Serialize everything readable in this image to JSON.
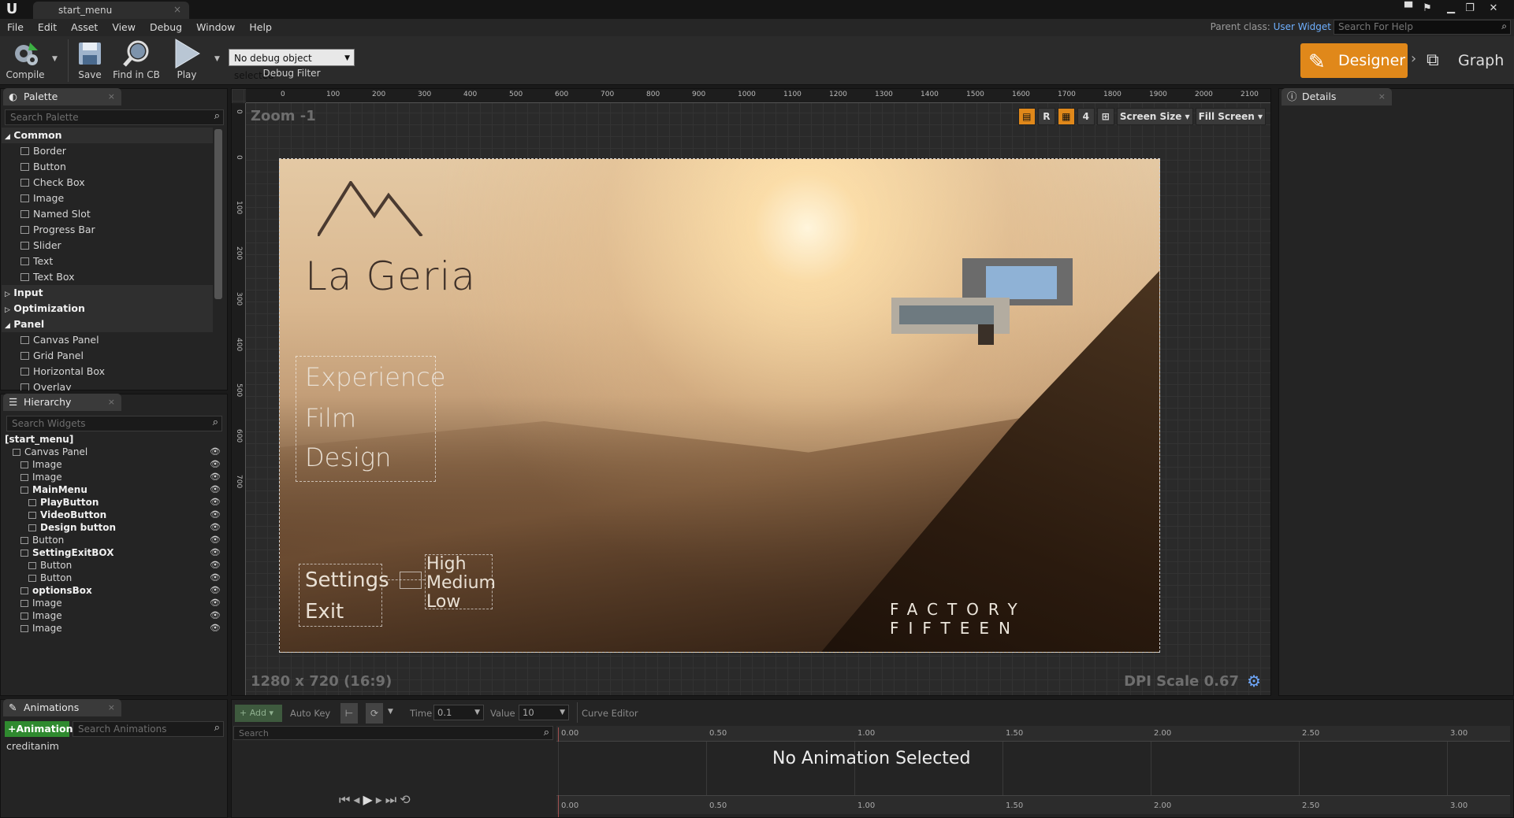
{
  "window": {
    "tab_title": "start_menu",
    "parent_class_label": "Parent class:",
    "parent_class_value": "User Widget",
    "help_search_placeholder": "Search For Help"
  },
  "menu": [
    "File",
    "Edit",
    "Asset",
    "View",
    "Debug",
    "Window",
    "Help"
  ],
  "toolbar": {
    "compile": "Compile",
    "save": "Save",
    "find_in_cb": "Find in CB",
    "play": "Play",
    "debug_object": "No debug object selected",
    "debug_filter": "Debug Filter",
    "designer": "Designer",
    "graph": "Graph"
  },
  "palette": {
    "tab": "Palette",
    "search_placeholder": "Search Palette",
    "common": "Common",
    "common_items": [
      "Border",
      "Button",
      "Check Box",
      "Image",
      "Named Slot",
      "Progress Bar",
      "Slider",
      "Text",
      "Text Box"
    ],
    "input": "Input",
    "optimization": "Optimization",
    "panel": "Panel",
    "panel_items": [
      "Canvas Panel",
      "Grid Panel",
      "Horizontal Box",
      "Overlay"
    ]
  },
  "hierarchy": {
    "tab": "Hierarchy",
    "search_placeholder": "Search Widgets",
    "items": [
      {
        "label": "[start_menu]",
        "indent": 0,
        "bold": true
      },
      {
        "label": "Canvas Panel",
        "indent": 1,
        "bold": false
      },
      {
        "label": "Image",
        "indent": 2,
        "bold": false
      },
      {
        "label": "Image",
        "indent": 2,
        "bold": false
      },
      {
        "label": "MainMenu",
        "indent": 2,
        "bold": true
      },
      {
        "label": "PlayButton",
        "indent": 3,
        "bold": true
      },
      {
        "label": "VideoButton",
        "indent": 3,
        "bold": true
      },
      {
        "label": "Design button",
        "indent": 3,
        "bold": true
      },
      {
        "label": "Button",
        "indent": 2,
        "bold": false
      },
      {
        "label": "SettingExitBOX",
        "indent": 2,
        "bold": true
      },
      {
        "label": "Button",
        "indent": 3,
        "bold": false
      },
      {
        "label": "Button",
        "indent": 3,
        "bold": false
      },
      {
        "label": "optionsBox",
        "indent": 2,
        "bold": true
      },
      {
        "label": "Image",
        "indent": 2,
        "bold": false
      },
      {
        "label": "Image",
        "indent": 2,
        "bold": false
      },
      {
        "label": "Image",
        "indent": 2,
        "bold": false
      }
    ]
  },
  "viewport": {
    "zoom": "Zoom -1",
    "resolution": "1280 x 720 (16:9)",
    "dpi": "DPI Scale 0.67",
    "ruler_x": [
      "0",
      "100",
      "200",
      "300",
      "400",
      "500",
      "600",
      "700",
      "800",
      "900",
      "1000",
      "1100",
      "1200",
      "1300",
      "1400",
      "1500",
      "1600",
      "1700",
      "1800",
      "1900",
      "2000",
      "2100"
    ],
    "ruler_y": [
      "0",
      "0",
      "100",
      "200",
      "300",
      "400",
      "500",
      "600",
      "700"
    ],
    "tools": {
      "r": "R",
      "four": "4",
      "screen_size": "Screen Size",
      "fill_screen": "Fill Screen"
    }
  },
  "canvas": {
    "logo": "La Geria",
    "menu_options": [
      "Experience",
      "Film",
      "Design"
    ],
    "settings": "Settings",
    "exit": "Exit",
    "quality": [
      "High",
      "Medium",
      "Low"
    ],
    "brand": "FACTORY FIFTEEN"
  },
  "details": {
    "tab": "Details"
  },
  "animations": {
    "tab": "Animations",
    "add_button": "+Animation",
    "search_placeholder": "Search Animations",
    "items": [
      "creditanim"
    ]
  },
  "timeline": {
    "add": "Add",
    "auto_key": "Auto Key",
    "time_label": "Time",
    "time_value": "0.1",
    "value_label": "Value",
    "value_value": "10",
    "curve_editor": "Curve Editor",
    "search_placeholder": "Search",
    "no_animation": "No Animation Selected",
    "ticks": [
      "0.00",
      "0.50",
      "1.00",
      "1.50",
      "2.00",
      "2.50",
      "3.00"
    ]
  },
  "colors": {
    "accent": "#e0881a",
    "link": "#6fb0ff"
  }
}
